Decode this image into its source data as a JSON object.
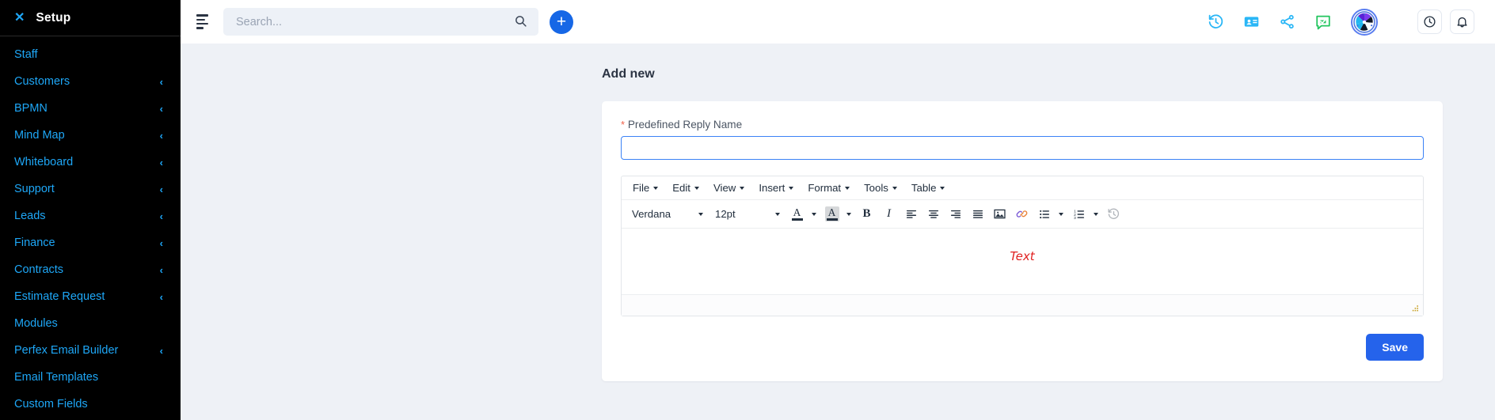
{
  "sidebar": {
    "title": "Setup",
    "close_icon": "close-icon",
    "items": [
      {
        "label": "Staff",
        "expandable": false
      },
      {
        "label": "Customers",
        "expandable": true
      },
      {
        "label": "BPMN",
        "expandable": true
      },
      {
        "label": "Mind Map",
        "expandable": true
      },
      {
        "label": "Whiteboard",
        "expandable": true
      },
      {
        "label": "Support",
        "expandable": true
      },
      {
        "label": "Leads",
        "expandable": true
      },
      {
        "label": "Finance",
        "expandable": true
      },
      {
        "label": "Contracts",
        "expandable": true
      },
      {
        "label": "Estimate Request",
        "expandable": true
      },
      {
        "label": "Modules",
        "expandable": false
      },
      {
        "label": "Perfex Email Builder",
        "expandable": true
      },
      {
        "label": "Email Templates",
        "expandable": false
      },
      {
        "label": "Custom Fields",
        "expandable": false
      }
    ],
    "chevron": "‹",
    "link_color": "#1ea7f7",
    "background": "#000000"
  },
  "topbar": {
    "menu_toggle_icon": "hamburger-icon",
    "search": {
      "placeholder": "Search...",
      "value": "",
      "icon": "search-icon"
    },
    "add_button": {
      "label": "+",
      "icon": "plus-icon",
      "color": "#1667e6"
    },
    "icons": [
      {
        "name": "history-icon",
        "color": "#29b6f6"
      },
      {
        "name": "contact-card-icon",
        "color": "#29b6f6"
      },
      {
        "name": "share-icon",
        "color": "#29b6f6"
      },
      {
        "name": "chat-check-icon",
        "color": "#22c55e"
      }
    ],
    "avatar": {
      "name": "user-avatar",
      "border_color": "#5a7ef0"
    },
    "right_icons": [
      {
        "name": "clock-icon"
      },
      {
        "name": "bell-icon"
      }
    ]
  },
  "main": {
    "page_title": "Add new",
    "form": {
      "field_label": "Predefined Reply Name",
      "required_marker": "*",
      "field_value": "",
      "field_focused": true
    },
    "save_label": "Save",
    "save_color": "#2563eb"
  },
  "editor": {
    "menubar": [
      {
        "label": "File"
      },
      {
        "label": "Edit"
      },
      {
        "label": "View"
      },
      {
        "label": "Insert"
      },
      {
        "label": "Format"
      },
      {
        "label": "Tools"
      },
      {
        "label": "Table"
      }
    ],
    "toolbar": {
      "font_family": "Verdana",
      "font_size": "12pt",
      "forecolor_icon": "text-color-icon",
      "backcolor_icon": "background-color-icon",
      "bold_glyph": "B",
      "italic_glyph": "I",
      "buttons": [
        {
          "name": "align-left-icon"
        },
        {
          "name": "align-center-icon"
        },
        {
          "name": "align-right-icon"
        },
        {
          "name": "align-justify-icon"
        },
        {
          "name": "insert-image-icon"
        },
        {
          "name": "insert-link-icon"
        },
        {
          "name": "bullet-list-icon"
        },
        {
          "name": "numbered-list-icon"
        },
        {
          "name": "restore-draft-icon"
        }
      ]
    },
    "content": "Text",
    "content_color": "#e02020",
    "resize_handle": "resize-grip-icon"
  }
}
